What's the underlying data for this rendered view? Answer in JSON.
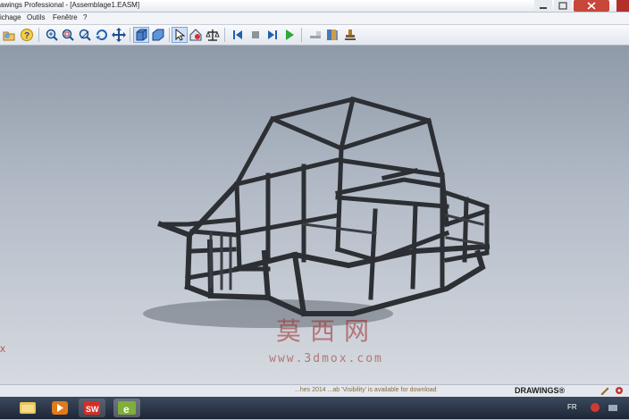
{
  "window": {
    "title": "awings Professional - [Assemblage1.EASM]"
  },
  "menu": {
    "items": [
      "ichage",
      "Outils",
      "Fenêtre",
      "?"
    ]
  },
  "toolbar": {
    "icons": [
      "open-icon",
      "help-icon",
      "zoom-fit-icon",
      "zoom-window-icon",
      "zoom-area-icon",
      "rotate-icon",
      "pan-icon",
      "shaded-view-icon",
      "view-orient-icon",
      "select-icon",
      "home-view-icon",
      "measure-icon",
      "first-frame-icon",
      "stop-icon",
      "next-frame-icon",
      "play-icon",
      "section-icon",
      "book-icon",
      "stamp-icon"
    ]
  },
  "viewport": {
    "left_edge_mark": "X"
  },
  "watermark": {
    "text": "莫西网",
    "url": "www.3dmox.com"
  },
  "statusbar": {
    "message": "...hes 2014 ...ab 'Visibility' is available for download",
    "logo": "DRAWINGS®"
  },
  "taskbar": {
    "language": "FR"
  }
}
